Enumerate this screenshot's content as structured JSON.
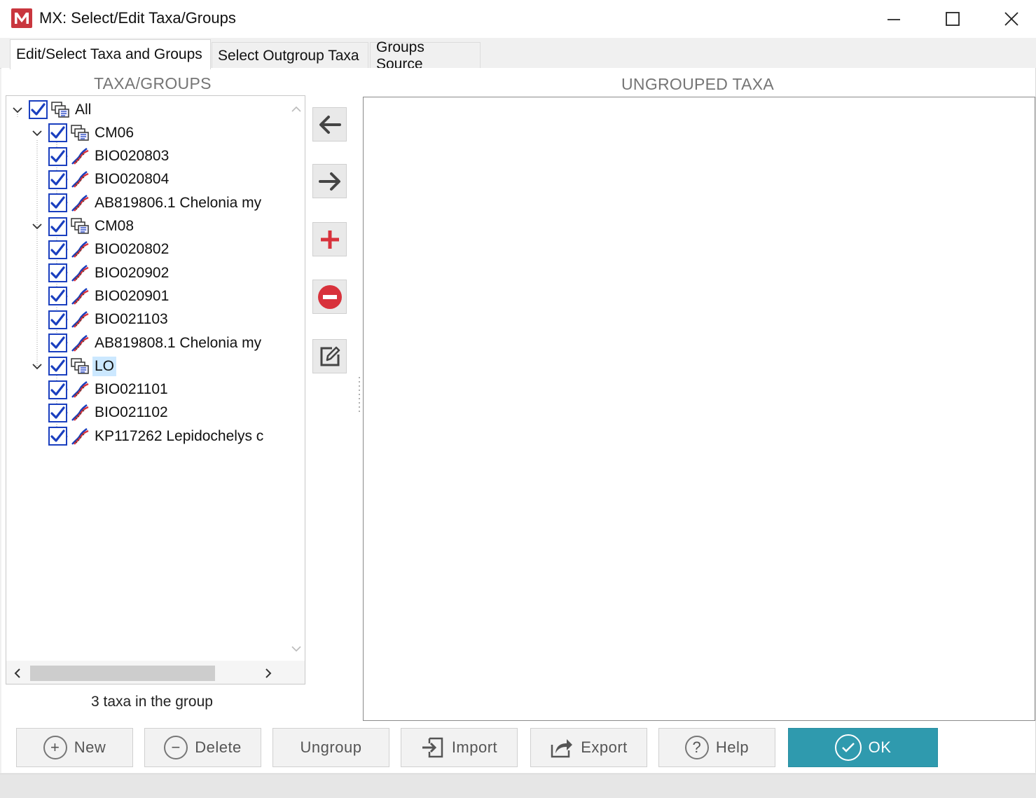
{
  "window": {
    "title": "MX: Select/Edit Taxa/Groups",
    "controls": [
      "minimize-icon",
      "maximize-icon",
      "close-icon"
    ]
  },
  "tabs": [
    {
      "label": "Edit/Select Taxa and Groups",
      "active": true
    },
    {
      "label": "Select Outgroup Taxa",
      "active": false
    },
    {
      "label": "Groups Source",
      "active": false
    }
  ],
  "left_panel": {
    "title": "TAXA/GROUPS",
    "tree": [
      {
        "label": "All",
        "type": "group",
        "checked": true,
        "level": 0
      },
      {
        "label": "CM06",
        "type": "group",
        "checked": true,
        "level": 1
      },
      {
        "label": "BIO020803",
        "type": "taxon",
        "checked": true,
        "level": 2
      },
      {
        "label": "BIO020804",
        "type": "taxon",
        "checked": true,
        "level": 2
      },
      {
        "label": "AB819806.1 Chelonia my",
        "type": "taxon",
        "checked": true,
        "level": 2
      },
      {
        "label": "CM08",
        "type": "group",
        "checked": true,
        "level": 1
      },
      {
        "label": "BIO020802",
        "type": "taxon",
        "checked": true,
        "level": 2
      },
      {
        "label": "BIO020902",
        "type": "taxon",
        "checked": true,
        "level": 2
      },
      {
        "label": "BIO020901",
        "type": "taxon",
        "checked": true,
        "level": 2
      },
      {
        "label": "BIO021103",
        "type": "taxon",
        "checked": true,
        "level": 2
      },
      {
        "label": "AB819808.1 Chelonia my",
        "type": "taxon",
        "checked": true,
        "level": 2
      },
      {
        "label": "LO",
        "type": "group",
        "checked": true,
        "level": 1,
        "selected": true
      },
      {
        "label": "BIO021101",
        "type": "taxon",
        "checked": true,
        "level": 2
      },
      {
        "label": "BIO021102",
        "type": "taxon",
        "checked": true,
        "level": 2
      },
      {
        "label": "KP117262 Lepidochelys c",
        "type": "taxon",
        "checked": true,
        "level": 2
      }
    ],
    "status": "3 taxa in the group"
  },
  "middle_buttons": [
    "arrow-left-icon",
    "arrow-right-icon",
    "plus-icon",
    "minus-circle-icon",
    "edit-icon"
  ],
  "right_panel": {
    "title": "UNGROUPED TAXA",
    "items": []
  },
  "buttons": {
    "new": "New",
    "delete": "Delete",
    "ungroup": "Ungroup",
    "import": "Import",
    "export": "Export",
    "help": "Help",
    "ok": "OK"
  },
  "colors": {
    "checkbox": "#1a3fbf",
    "ok_button": "#2f9aae",
    "add_icon": "#d8323c",
    "selection": "#cce8ff"
  }
}
